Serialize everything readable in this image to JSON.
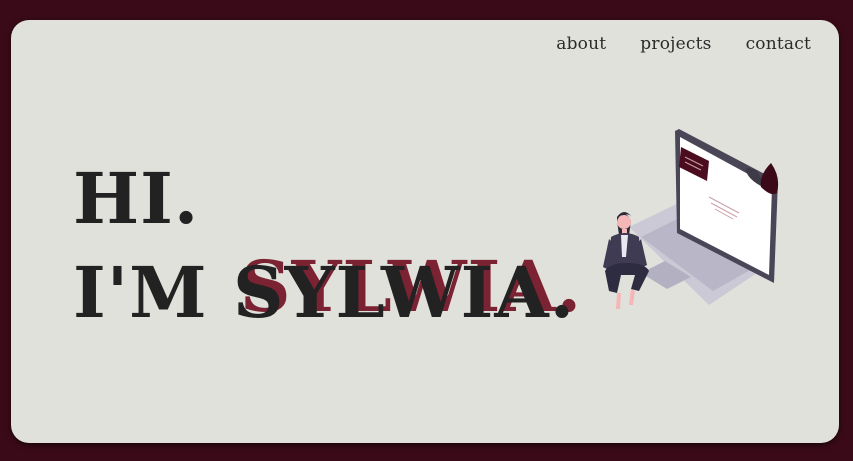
{
  "nav": {
    "items": [
      {
        "label": "about"
      },
      {
        "label": "projects"
      },
      {
        "label": "contact"
      }
    ]
  },
  "hero": {
    "line1": "HI.",
    "line2_prefix": "I'M ",
    "name": "SYLWIA."
  },
  "colors": {
    "background": "#3a0a18",
    "card": "#e1e1dc",
    "text": "#222222",
    "accent": "#7b2233"
  },
  "illustration": {
    "icon": "woman-with-laptop-illustration"
  }
}
